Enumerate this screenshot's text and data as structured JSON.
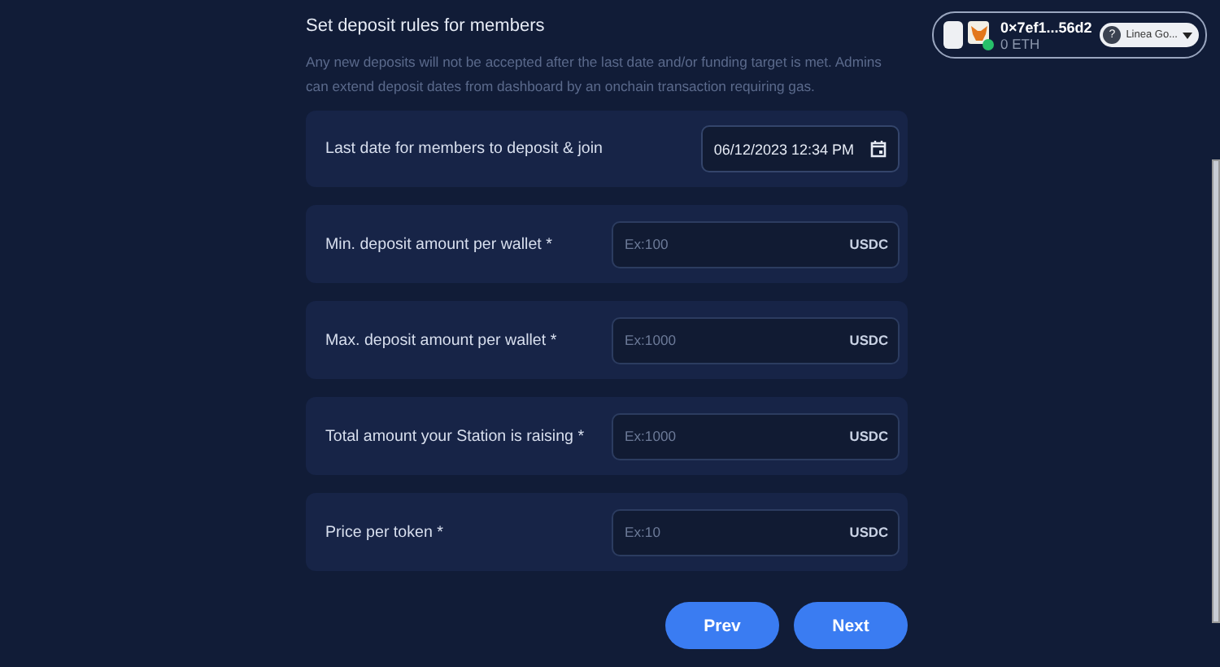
{
  "wallet": {
    "address": "0×7ef1...56d2",
    "balance": "0 ETH",
    "network": "Linea Go...",
    "network_icon": "?",
    "connected": true
  },
  "section": {
    "title": "Set deposit rules for members",
    "description": "Any new deposits will not be accepted after the last date and/or funding target is met. Admins can extend deposit dates from dashboard by an onchain transaction requiring gas."
  },
  "fields": [
    {
      "kind": "date",
      "label": "Last date for members to deposit & join",
      "value": "06/12/2023 12:34 PM"
    },
    {
      "kind": "amount",
      "label": "Min. deposit amount per wallet *",
      "placeholder": "Ex:100",
      "unit": "USDC"
    },
    {
      "kind": "amount",
      "label": "Max. deposit amount per wallet *",
      "placeholder": "Ex:1000",
      "unit": "USDC"
    },
    {
      "kind": "amount",
      "label": "Total amount your Station is raising *",
      "placeholder": "Ex:1000",
      "unit": "USDC"
    },
    {
      "kind": "amount",
      "label": "Price per token *",
      "placeholder": "Ex:10",
      "unit": "USDC"
    }
  ],
  "buttons": [
    "Prev",
    "Next"
  ]
}
